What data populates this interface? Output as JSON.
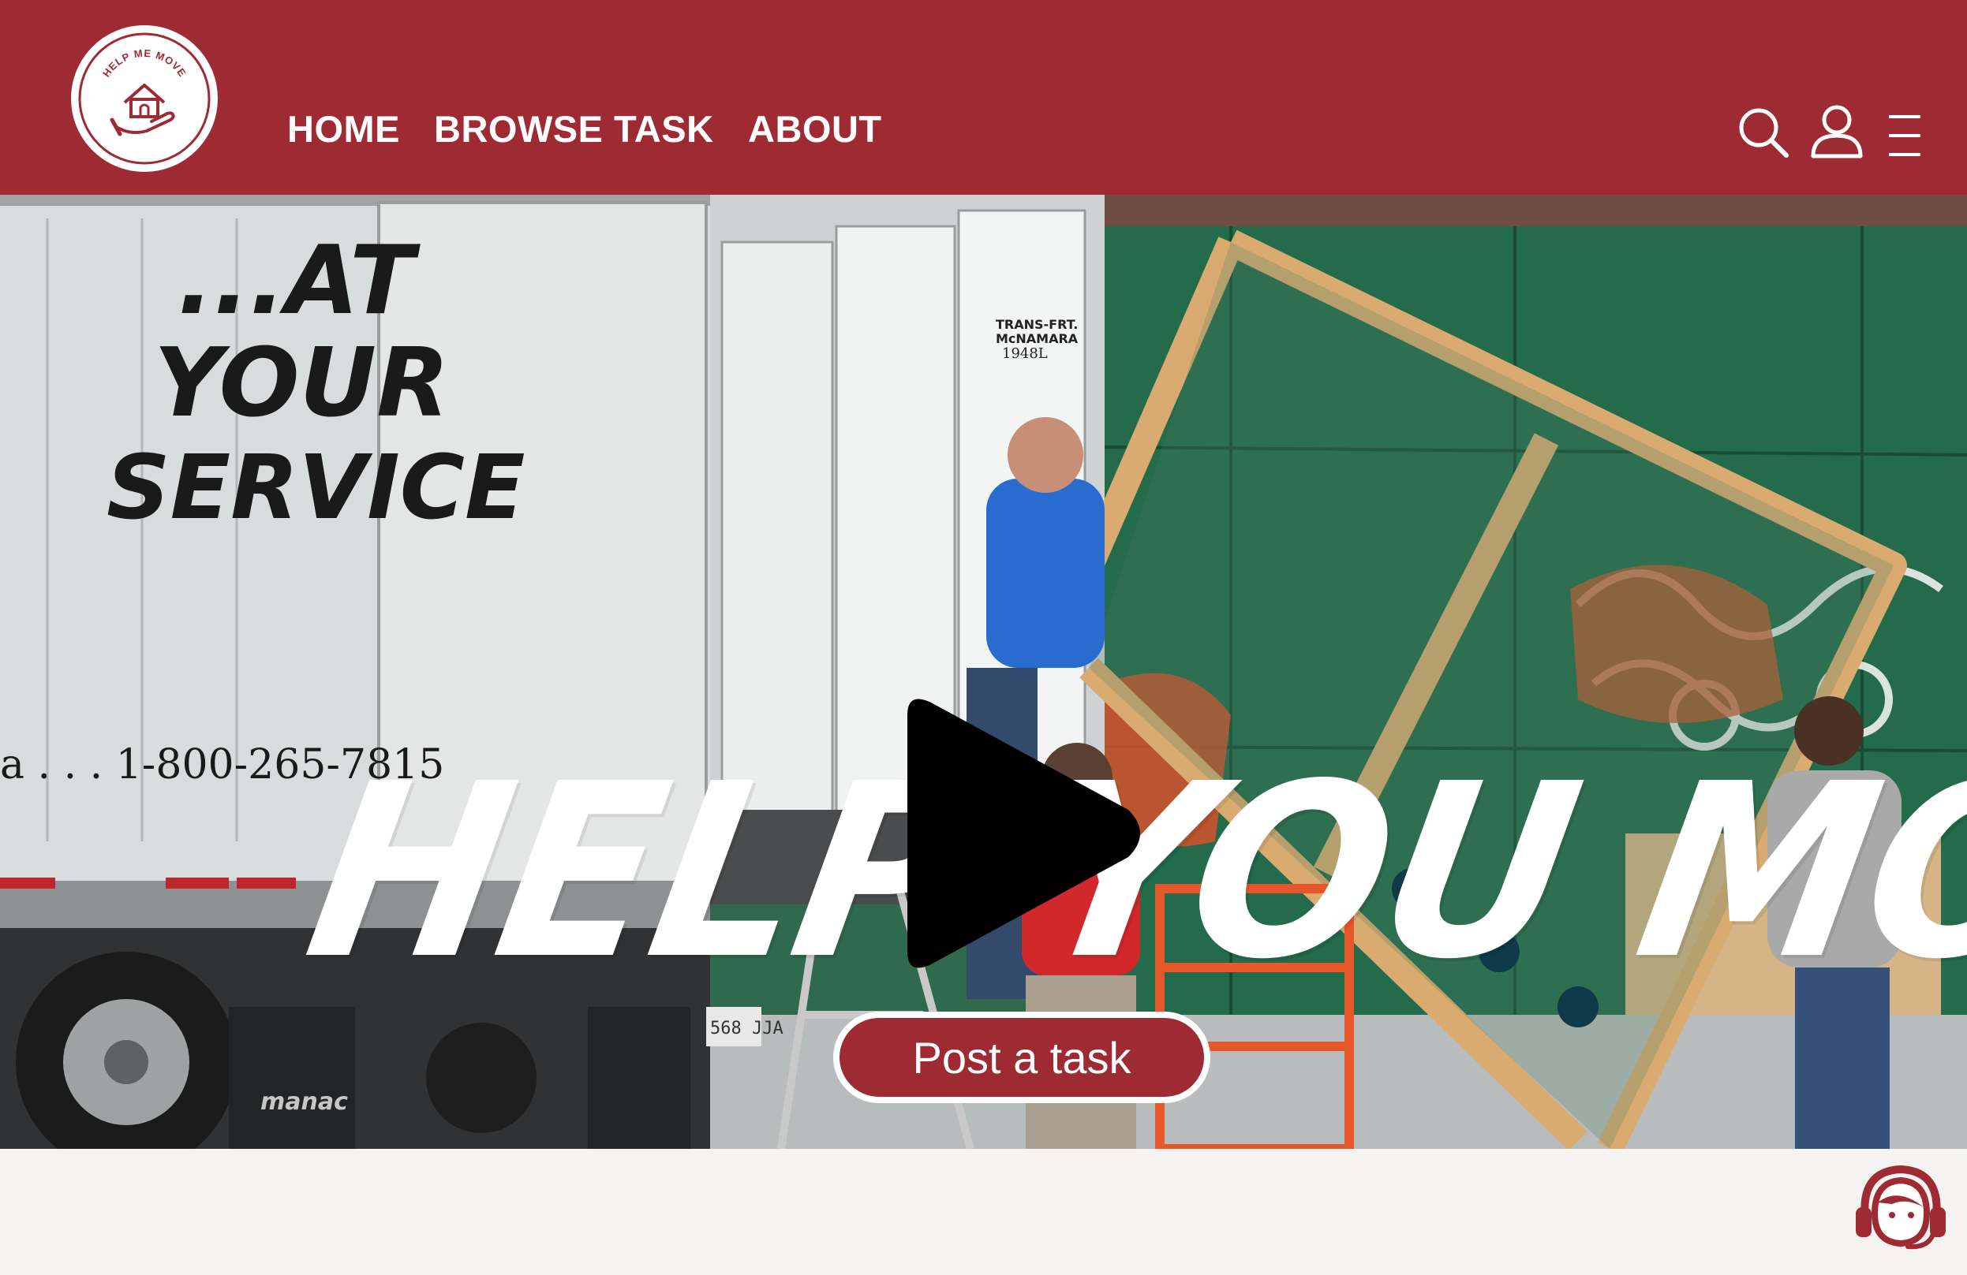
{
  "brand": {
    "logo_text": "HELP ME MOVE",
    "primary_color": "#9e2a33",
    "background_color": "#f5f2f2"
  },
  "nav": {
    "items": [
      {
        "label": "HOME"
      },
      {
        "label": "BROWSE TASK"
      },
      {
        "label": "ABOUT"
      }
    ]
  },
  "header_icons": [
    "search-icon",
    "user-icon",
    "menu-icon"
  ],
  "hero": {
    "title": "HELP YOU MOVE",
    "cta_label": "Post a task",
    "media_control": "play-icon",
    "scene_text": {
      "truck_slogan_1": "...AT",
      "truck_slogan_2": "YOUR",
      "truck_slogan_3": "SERVICE",
      "truck_phone": "a . . . 1-800-265-7815",
      "door_label_1": "TRANS-FRT.",
      "door_label_2": "McNAMARA",
      "door_label_3": "1948L",
      "mudflap_brand": "manac",
      "plate": "568 JJA"
    }
  },
  "footer": {
    "support_icon": "customer-support-icon"
  }
}
